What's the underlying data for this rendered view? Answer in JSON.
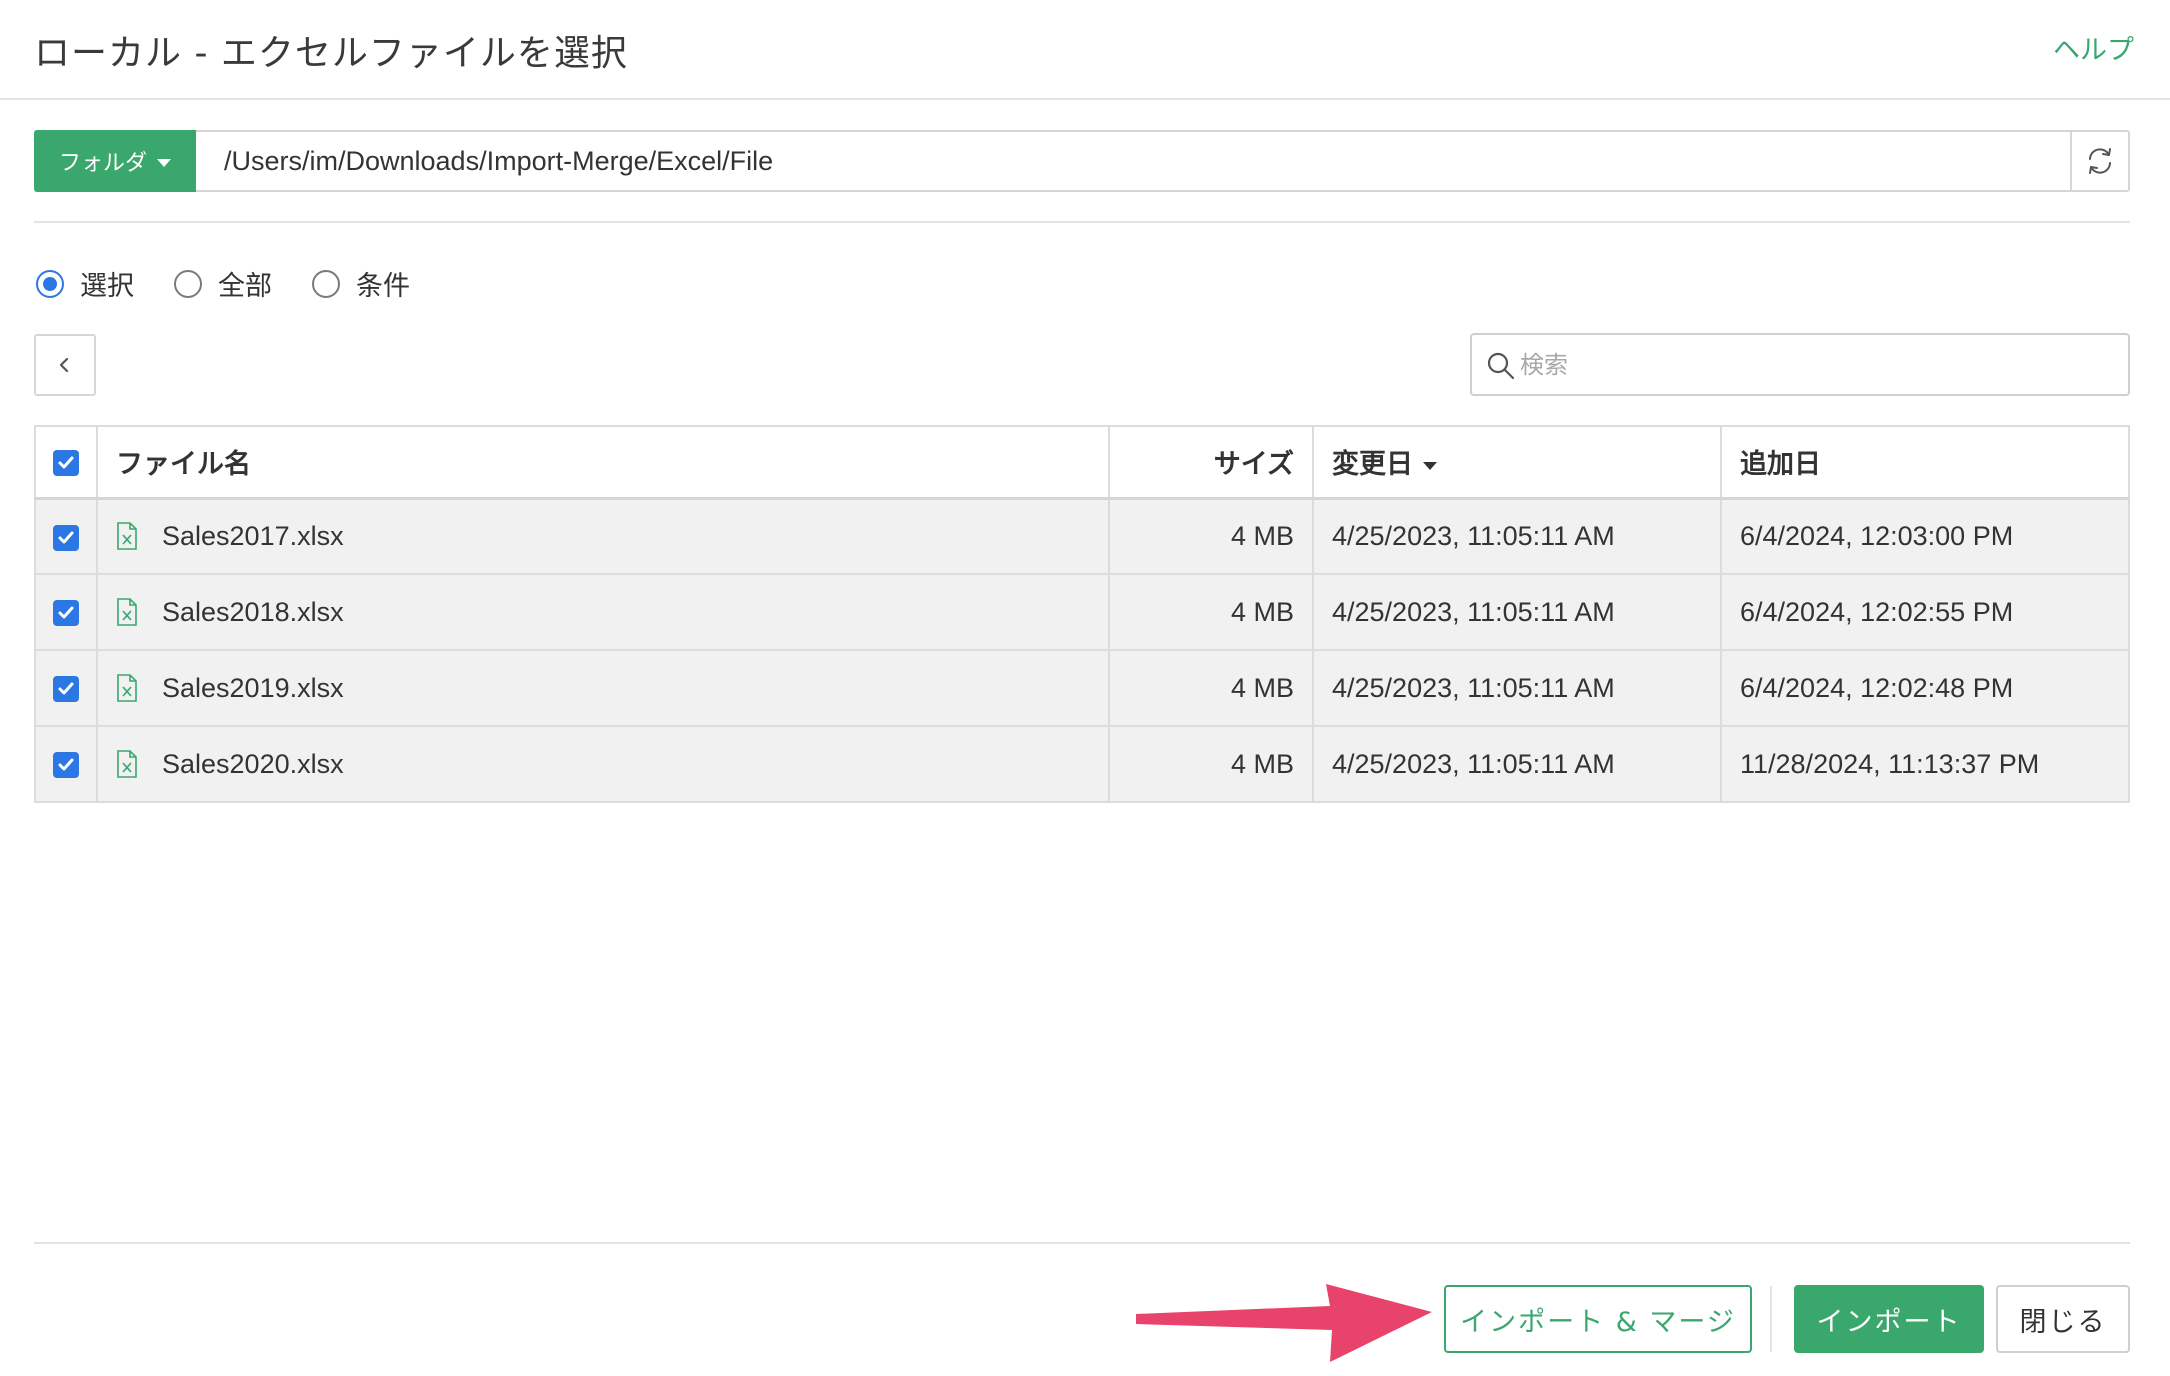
{
  "header": {
    "title": "ローカル - エクセルファイルを選択",
    "help_label": "ヘルプ"
  },
  "path_bar": {
    "folder_label": "フォルダ",
    "path_value": "/Users/im/Downloads/Import-Merge/Excel/File"
  },
  "selection_mode": {
    "options": [
      {
        "label": "選択",
        "checked": true
      },
      {
        "label": "全部",
        "checked": false
      },
      {
        "label": "条件",
        "checked": false
      }
    ]
  },
  "search": {
    "placeholder": "検索"
  },
  "table": {
    "columns": [
      "ファイル名",
      "サイズ",
      "変更日",
      "追加日"
    ],
    "sorted_column": "変更日",
    "rows": [
      {
        "name": "Sales2017.xlsx",
        "size": "4 MB",
        "modified": "4/25/2023, 11:05:11 AM",
        "added": "6/4/2024, 12:03:00 PM",
        "checked": true
      },
      {
        "name": "Sales2018.xlsx",
        "size": "4 MB",
        "modified": "4/25/2023, 11:05:11 AM",
        "added": "6/4/2024, 12:02:55 PM",
        "checked": true
      },
      {
        "name": "Sales2019.xlsx",
        "size": "4 MB",
        "modified": "4/25/2023, 11:05:11 AM",
        "added": "6/4/2024, 12:02:48 PM",
        "checked": true
      },
      {
        "name": "Sales2020.xlsx",
        "size": "4 MB",
        "modified": "4/25/2023, 11:05:11 AM",
        "added": "11/28/2024, 11:13:37 PM",
        "checked": true
      }
    ]
  },
  "footer": {
    "import_merge_label": "インポート & マージ",
    "import_label": "インポート",
    "close_label": "閉じる"
  },
  "colors": {
    "accent_green": "#3aa76d",
    "checkbox_blue": "#2b78e4",
    "annotation_arrow": "#e8436b"
  }
}
